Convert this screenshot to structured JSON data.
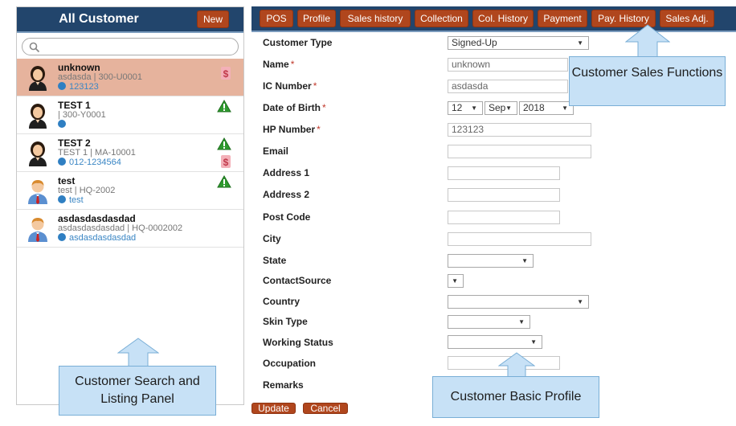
{
  "left": {
    "title": "All Customer",
    "new_label": "New",
    "search_placeholder": "",
    "customers": [
      {
        "name": "unknown",
        "sub": "asdasda  |  300-U0001",
        "phone": "123123",
        "avatar": "female-avatar-icon"
      },
      {
        "name": "TEST 1",
        "sub": " |  300-Y0001",
        "phone": "",
        "avatar": "female-avatar-icon"
      },
      {
        "name": "TEST 2",
        "sub": "TEST 1  |  MA-10001",
        "phone": "012-1234564",
        "avatar": "female-avatar-icon"
      },
      {
        "name": "test",
        "sub": "test  |  HQ-2002",
        "phone": "test",
        "avatar": "male-avatar-icon"
      },
      {
        "name": "asdasdasdasdad",
        "sub": "asdasdasdasdad  |  HQ-0002002",
        "phone": "asdasdasdasdad",
        "avatar": "male-avatar-icon"
      }
    ]
  },
  "tabs": [
    "POS",
    "Profile",
    "Sales history",
    "Collection",
    "Col. History",
    "Payment",
    "Pay. History",
    "Sales Adj."
  ],
  "form": {
    "customer_type_label": "Customer Type",
    "customer_type_value": "Signed-Up",
    "name_label": "Name",
    "name_value": "unknown",
    "ic_label": "IC Number",
    "ic_value": "asdasda",
    "dob_label": "Date of Birth",
    "dob_day": "12",
    "dob_month": "Sep",
    "dob_year": "2018",
    "hp_label": "HP Number",
    "hp_value": "123123",
    "email_label": "Email",
    "address1_label": "Address 1",
    "address2_label": "Address 2",
    "postcode_label": "Post Code",
    "city_label": "City",
    "state_label": "State",
    "contact_source_label": "ContactSource",
    "country_label": "Country",
    "skin_type_label": "Skin Type",
    "working_status_label": "Working Status",
    "occupation_label": "Occupation",
    "remarks_label": "Remarks",
    "required_mark": "*"
  },
  "buttons": {
    "update": "Update",
    "cancel": "Cancel"
  },
  "callouts": {
    "sales_functions": "Customer Sales Functions",
    "search_panel": "Customer Search and Listing Panel",
    "basic_profile": "Customer Basic Profile"
  },
  "colors": {
    "header_bg": "#22456c",
    "button_bg": "#b0461d",
    "selected_row": "#e6b39d",
    "callout_bg": "#c7e1f6"
  }
}
